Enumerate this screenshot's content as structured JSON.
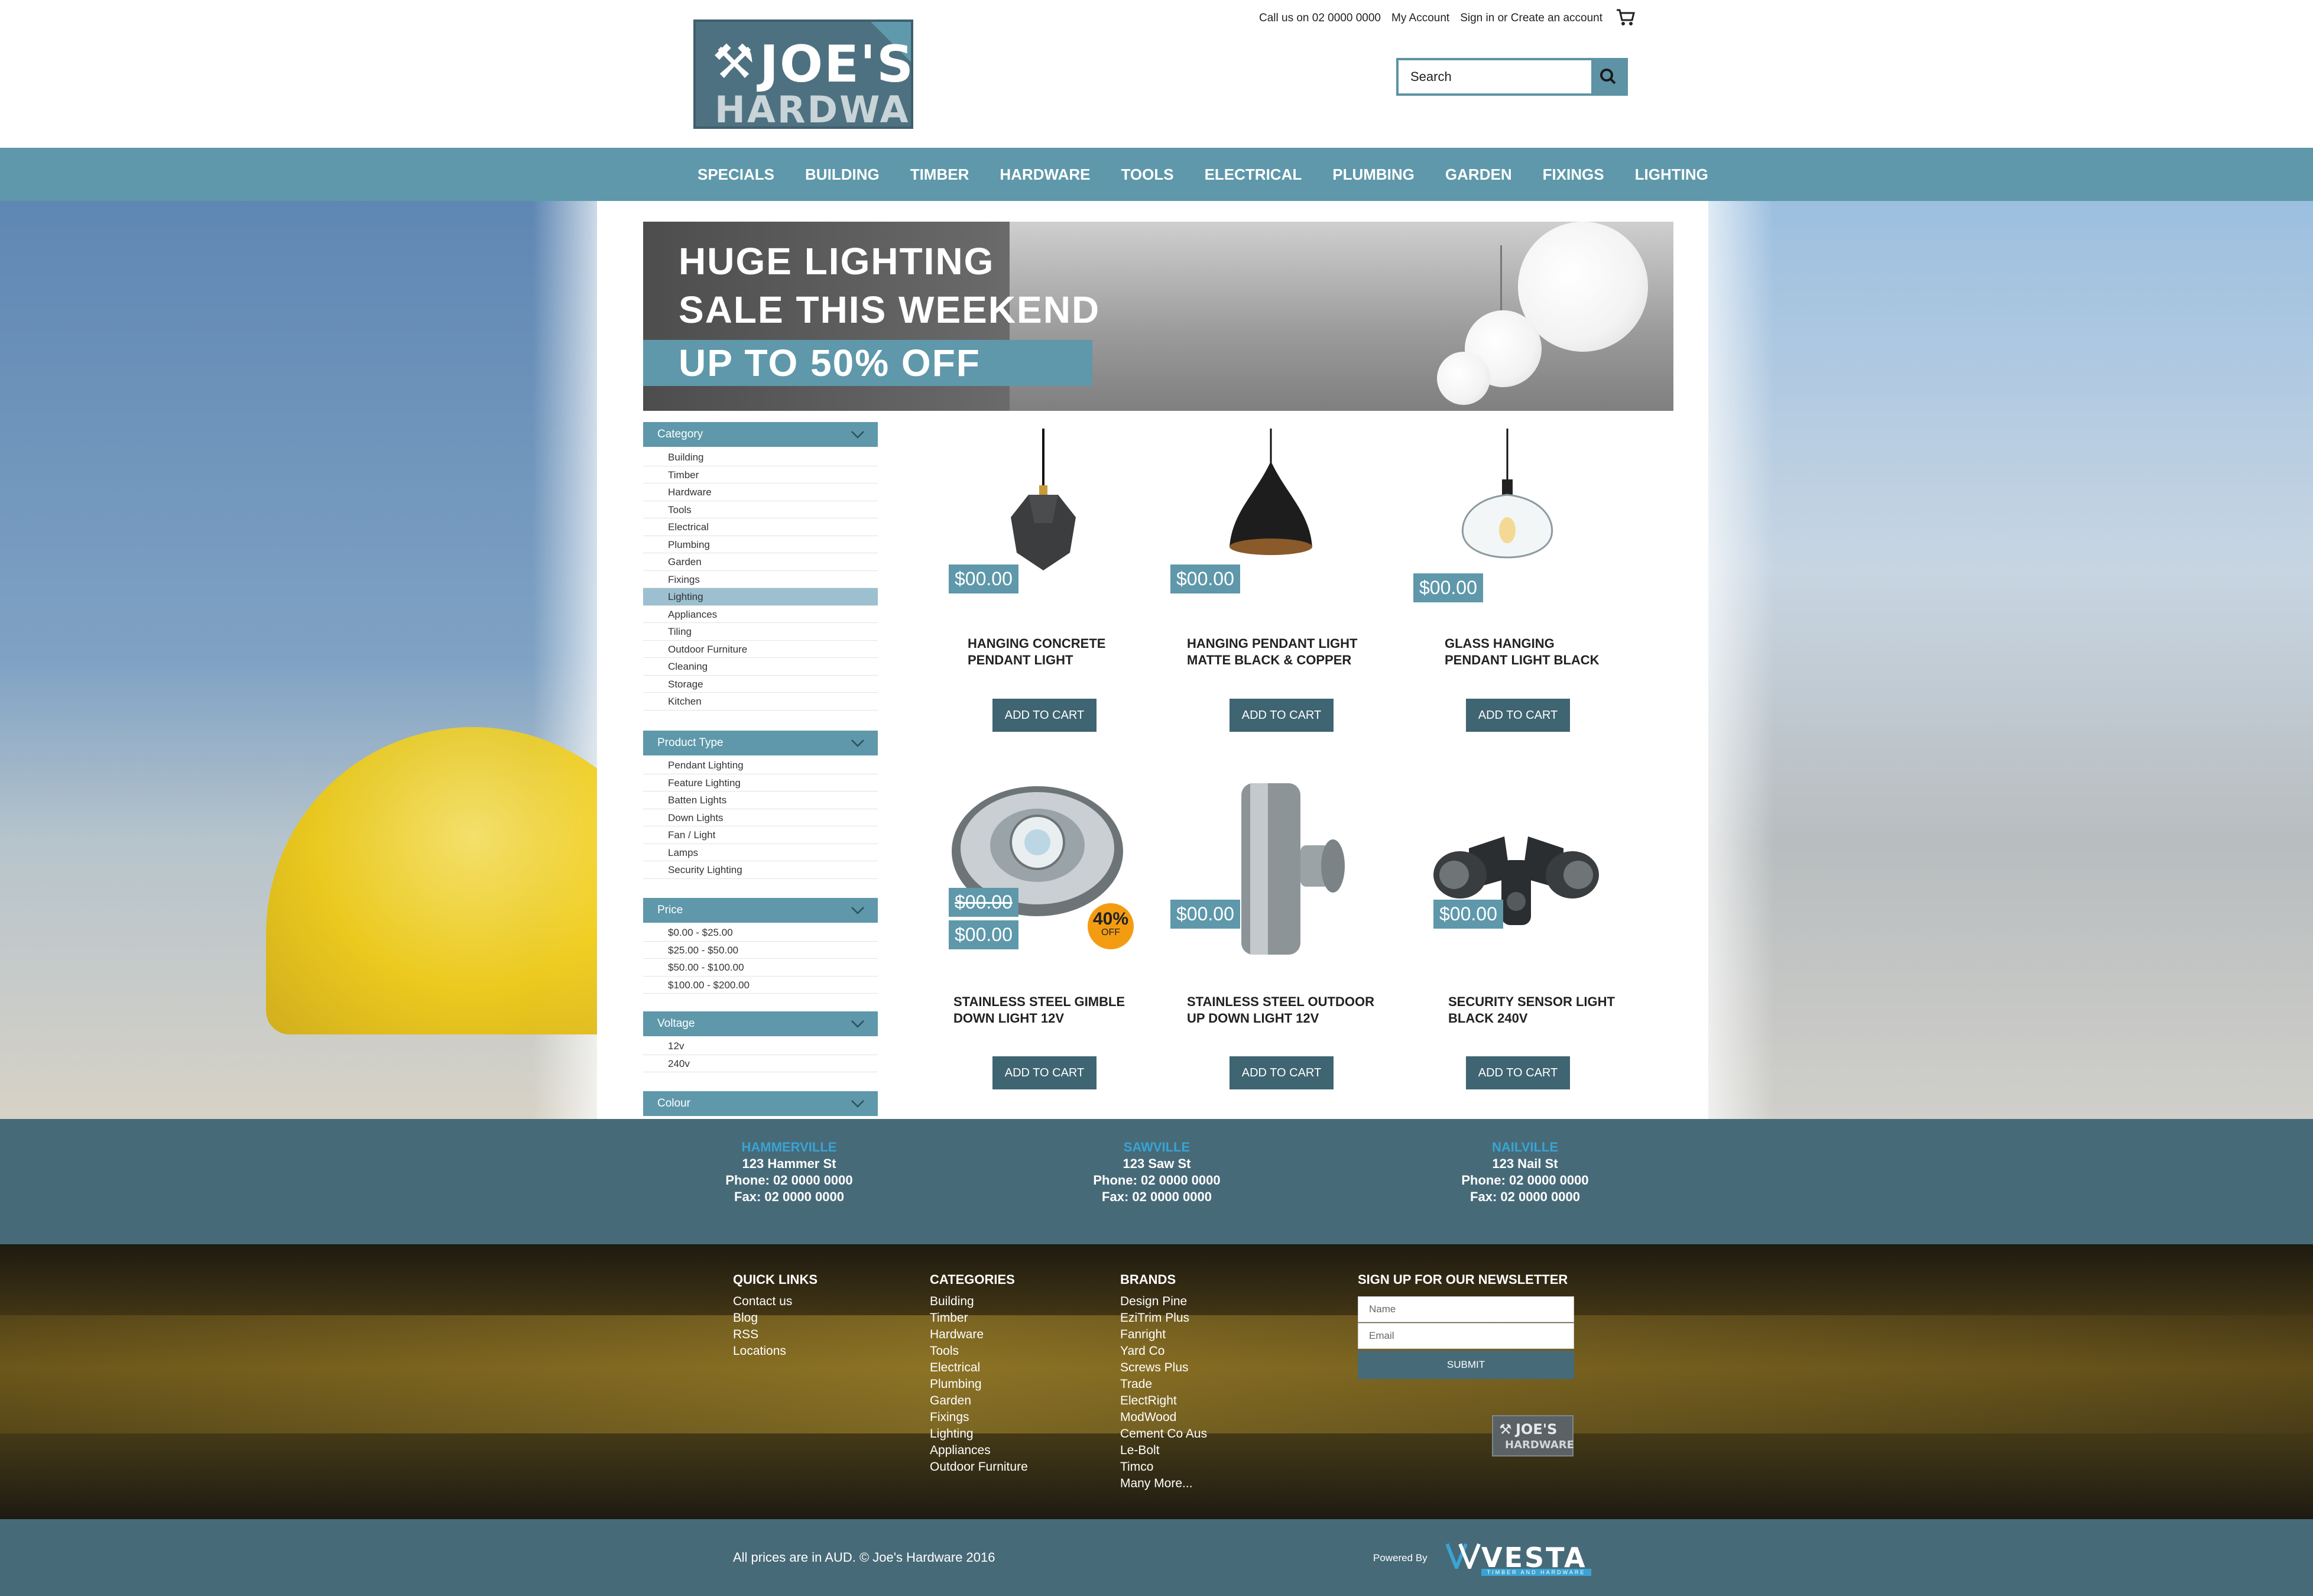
{
  "header": {
    "logo": {
      "line1": "JOE'S",
      "line2": "HARDWARE"
    },
    "phone": "Call us on 02 0000 0000",
    "my_account": "My Account",
    "sign_in": "Sign in or Create an account",
    "search_placeholder": "Search"
  },
  "nav": {
    "items": [
      "SPECIALS",
      "BUILDING",
      "TIMBER",
      "HARDWARE",
      "TOOLS",
      "ELECTRICAL",
      "PLUMBING",
      "GARDEN",
      "FIXINGS",
      "LIGHTING"
    ]
  },
  "hero": {
    "line1": "HUGE LIGHTING",
    "line2": "SALE THIS WEEKEND",
    "line3": "UP TO 50% OFF"
  },
  "sidebar": {
    "category": {
      "title": "Category",
      "items": [
        "Building",
        "Timber",
        "Hardware",
        "Tools",
        "Electrical",
        "Plumbing",
        "Garden",
        "Fixings",
        "Lighting",
        "Appliances",
        "Tiling",
        "Outdoor Furniture",
        "Cleaning",
        "Storage",
        "Kitchen"
      ],
      "active": "Lighting"
    },
    "product_type": {
      "title": "Product Type",
      "items": [
        "Pendant Lighting",
        "Feature Lighting",
        "Batten Lights",
        "Down Lights",
        "Fan / Light",
        "Lamps",
        "Security Lighting"
      ]
    },
    "price": {
      "title": "Price",
      "items": [
        "$0.00 - $25.00",
        "$25.00 - $50.00",
        "$50.00 - $100.00",
        "$100.00 - $200.00"
      ]
    },
    "voltage": {
      "title": "Voltage",
      "items": [
        "12v",
        "240v"
      ]
    },
    "colour": {
      "title": "Colour"
    }
  },
  "products": [
    {
      "name_line1": "HANGING CONCRETE",
      "name_line2": "PENDANT LIGHT",
      "price": "$00.00",
      "cta": "ADD TO CART"
    },
    {
      "name_line1": "HANGING PENDANT LIGHT",
      "name_line2": "MATTE BLACK & COPPER",
      "price": "$00.00",
      "cta": "ADD TO CART"
    },
    {
      "name_line1": "GLASS HANGING",
      "name_line2": "PENDANT LIGHT BLACK",
      "price": "$00.00",
      "cta": "ADD TO CART"
    },
    {
      "name_line1": "STAINLESS STEEL GIMBLE",
      "name_line2": "DOWN LIGHT 12V",
      "price": "$00.00",
      "old_price": "$00.00",
      "badge_pct": "40%",
      "badge_off": "OFF",
      "cta": "ADD TO CART"
    },
    {
      "name_line1": "STAINLESS STEEL OUTDOOR",
      "name_line2": "UP DOWN LIGHT 12V",
      "price": "$00.00",
      "cta": "ADD TO CART"
    },
    {
      "name_line1": "SECURITY SENSOR LIGHT",
      "name_line2": "BLACK 240V",
      "price": "$00.00",
      "cta": "ADD TO CART"
    }
  ],
  "locations": [
    {
      "name": "HAMMERVILLE",
      "street": "123 Hammer St",
      "phone": "Phone: 02 0000 0000",
      "fax": "Fax: 02 0000 0000"
    },
    {
      "name": "SAWVILLE",
      "street": "123 Saw St",
      "phone": "Phone: 02 0000 0000",
      "fax": "Fax: 02 0000 0000"
    },
    {
      "name": "NAILVILLE",
      "street": "123 Nail St",
      "phone": "Phone: 02 0000 0000",
      "fax": "Fax: 02 0000 0000"
    }
  ],
  "footer": {
    "quick_links": {
      "title": "QUICK LINKS",
      "items": [
        "Contact us",
        "Blog",
        "RSS",
        "Locations"
      ]
    },
    "categories": {
      "title": "CATEGORIES",
      "items": [
        "Building",
        "Timber",
        "Hardware",
        "Tools",
        "Electrical",
        "Plumbing",
        "Garden",
        "Fixings",
        "Lighting",
        "Appliances",
        "Outdoor Furniture"
      ]
    },
    "brands": {
      "title": "BRANDS",
      "items": [
        "Design Pine",
        "EziTrim Plus",
        "Fanright",
        "Yard Co",
        "Screws Plus",
        "Trade",
        "ElectRight",
        "ModWood",
        "Cement Co Aus",
        "Le-Bolt",
        "Timco",
        "Many More..."
      ]
    },
    "newsletter": {
      "title": "SIGN UP FOR OUR NEWSLETTER",
      "name_placeholder": "Name",
      "email_placeholder": "Email",
      "submit": "SUBMIT"
    },
    "mini_logo": {
      "line1": "JOE'S",
      "line2": "HARDWARE"
    }
  },
  "bottom": {
    "copyright": "All prices are in AUD. © Joe's Hardware 2016",
    "powered_by": "Powered By",
    "vesta": "VESTA",
    "vesta_sub": "TIMBER AND HARDWARE"
  },
  "colors": {
    "accent": "#5e98aa",
    "dark_teal": "#476a78",
    "button": "#3f6472",
    "badge": "#f39c12",
    "location_name": "#3aa3d3"
  }
}
